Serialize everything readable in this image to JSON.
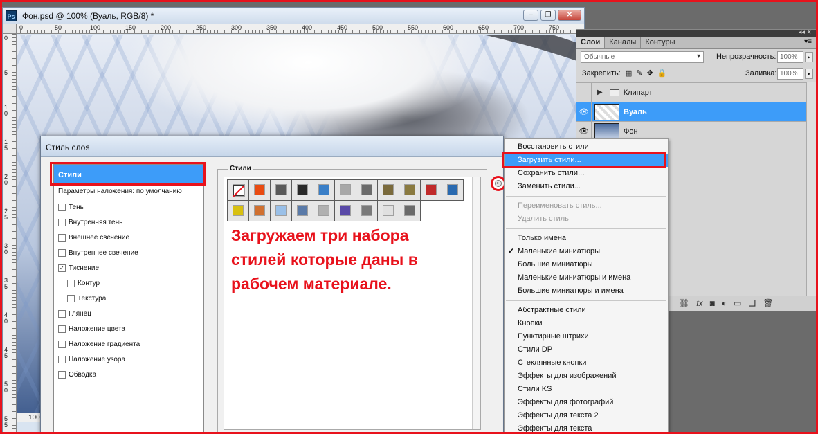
{
  "document": {
    "title": "Фон.psd @ 100% (Вуаль, RGB/8) *",
    "app_icon": "Ps",
    "zoom": "100%",
    "ruler_top": [
      "0",
      "50",
      "100",
      "150",
      "200",
      "250",
      "300",
      "350",
      "400",
      "450",
      "500",
      "550",
      "600",
      "650",
      "700",
      "750"
    ],
    "ruler_left": [
      "0",
      "5",
      "1 0",
      "1 5",
      "2 0",
      "2 5",
      "3 0",
      "3 5",
      "4 0",
      "4 5",
      "5 0",
      "5 5"
    ]
  },
  "layers_panel": {
    "tabs": [
      "Слои",
      "Каналы",
      "Контуры"
    ],
    "blend_mode": "Обычные",
    "opacity_label": "Непрозрачность:",
    "opacity_value": "100%",
    "lock_label": "Закрепить:",
    "fill_label": "Заливка:",
    "fill_value": "100%",
    "layers": [
      {
        "name": "Клипарт",
        "type": "group"
      },
      {
        "name": "Вуаль",
        "type": "layer",
        "selected": true
      },
      {
        "name": "Фон",
        "type": "background"
      }
    ]
  },
  "dialog": {
    "title": "Стиль слоя",
    "styles_header": "Стили",
    "blending_default": "Параметры наложения: по умолчанию",
    "effects": [
      {
        "label": "Тень",
        "checked": false,
        "indent": false
      },
      {
        "label": "Внутренняя тень",
        "checked": false,
        "indent": false
      },
      {
        "label": "Внешнее свечение",
        "checked": false,
        "indent": false
      },
      {
        "label": "Внутреннее свечение",
        "checked": false,
        "indent": false
      },
      {
        "label": "Тиснение",
        "checked": true,
        "indent": false
      },
      {
        "label": "Контур",
        "checked": false,
        "indent": true
      },
      {
        "label": "Текстура",
        "checked": false,
        "indent": true
      },
      {
        "label": "Глянец",
        "checked": false,
        "indent": false
      },
      {
        "label": "Наложение цвета",
        "checked": false,
        "indent": false
      },
      {
        "label": "Наложение градиента",
        "checked": false,
        "indent": false
      },
      {
        "label": "Наложение узора",
        "checked": false,
        "indent": false
      },
      {
        "label": "Обводка",
        "checked": false,
        "indent": false
      }
    ],
    "styles_group_label": "Стили",
    "swatch_colors": [
      "none",
      "#e94a10",
      "#5a5a5a",
      "#2a2a2a",
      "#3a7fc8",
      "#a8a8a8",
      "#6b6b6b",
      "#7a6a3c",
      "#8a7a40",
      "#c02a2a",
      "#2a6ab0",
      "#d8c010",
      "#d07030",
      "#9ac0e8",
      "#5a7aa8",
      "#b0b0b0",
      "#5a4aa8",
      "#7a7a7a",
      "#e0e0e0",
      "#6a6a6a"
    ],
    "annotation": "Загружаем три набора стилей которые даны в рабочем материале."
  },
  "menu": {
    "groups": [
      [
        {
          "label": "Восстановить стили"
        },
        {
          "label": "Загрузить стили...",
          "highlighted": true
        },
        {
          "label": "Сохранить стили..."
        },
        {
          "label": "Заменить стили..."
        }
      ],
      [
        {
          "label": "Переименовать стиль...",
          "disabled": true
        },
        {
          "label": "Удалить стиль",
          "disabled": true
        }
      ],
      [
        {
          "label": "Только имена"
        },
        {
          "label": "Маленькие миниатюры",
          "checked": true
        },
        {
          "label": "Большие миниатюры"
        },
        {
          "label": "Маленькие миниатюры и имена"
        },
        {
          "label": "Большие миниатюры и имена"
        }
      ],
      [
        {
          "label": "Абстрактные стили"
        },
        {
          "label": "Кнопки"
        },
        {
          "label": "Пунктирные штрихи"
        },
        {
          "label": "Стили DP"
        },
        {
          "label": "Стеклянные кнопки"
        },
        {
          "label": "Эффекты для изображений"
        },
        {
          "label": "Стили KS"
        },
        {
          "label": "Эффекты для фотографий"
        },
        {
          "label": "Эффекты для текста 2"
        },
        {
          "label": "Эффекты для текста"
        }
      ]
    ]
  }
}
